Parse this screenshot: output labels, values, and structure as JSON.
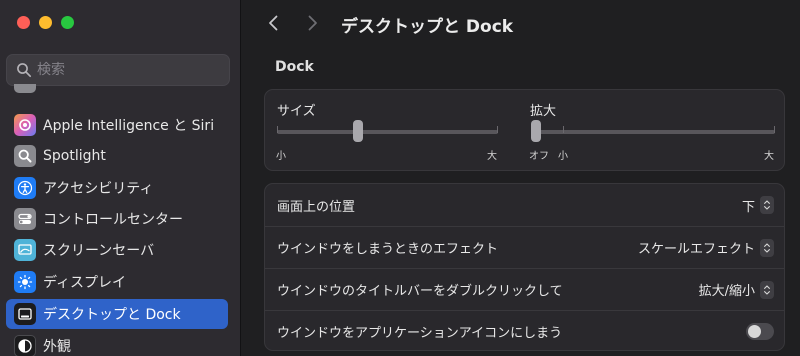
{
  "window": {
    "title": "デスクトップと Dock"
  },
  "search": {
    "placeholder": "検索"
  },
  "sidebar": {
    "items": [
      {
        "label": "Apple Intelligence と Siri",
        "icon": "apple-intelligence-siri-icon",
        "color": "#c46ad6"
      },
      {
        "label": "Spotlight",
        "icon": "spotlight-icon",
        "color": "#8a8a8f"
      },
      {
        "label": "アクセシビリティ",
        "icon": "accessibility-icon",
        "color": "#1f7cf5"
      },
      {
        "label": "コントロールセンター",
        "icon": "control-center-icon",
        "color": "#8a8a8f"
      },
      {
        "label": "スクリーンセーバ",
        "icon": "screen-saver-icon",
        "color": "#4fb3d8"
      },
      {
        "label": "ディスプレイ",
        "icon": "display-icon",
        "color": "#1f7cf5"
      },
      {
        "label": "デスクトップと Dock",
        "icon": "desktop-dock-icon",
        "color": "#1c1c1e",
        "active": true
      },
      {
        "label": "外観",
        "icon": "appearance-icon",
        "color": "#1c1c1e"
      }
    ]
  },
  "dock": {
    "section_title": "Dock",
    "size": {
      "label": "サイズ",
      "min_label": "小",
      "max_label": "大",
      "value": 0.36
    },
    "magnification": {
      "label": "拡大",
      "off_label": "オフ",
      "min_label": "小",
      "max_label": "大",
      "value": 0.0
    }
  },
  "settings": [
    {
      "label": "画面上の位置",
      "value": "下",
      "control": "popup"
    },
    {
      "label": "ウインドウをしまうときのエフェクト",
      "value": "スケールエフェクト",
      "control": "popup"
    },
    {
      "label": "ウインドウのタイトルバーをダブルクリックして",
      "value": "拡大/縮小",
      "control": "popup"
    },
    {
      "label": "ウインドウをアプリケーションアイコンにしまう",
      "value": "",
      "control": "toggle",
      "on": false
    }
  ],
  "colors": {
    "accent": "#2f63c9",
    "sidebar_bg": "#2d2b30",
    "main_bg": "#1f1f21"
  }
}
